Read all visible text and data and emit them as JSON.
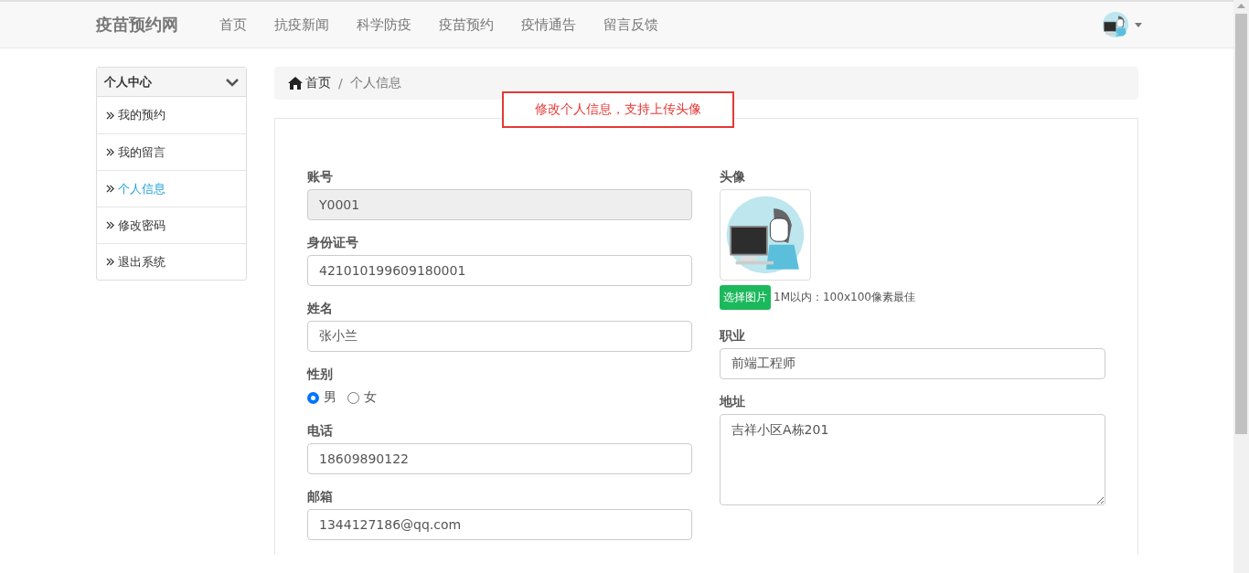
{
  "navbar": {
    "brand": "疫苗预约网",
    "links": [
      {
        "label": "首页",
        "selected": false
      },
      {
        "label": "抗疫新闻",
        "selected": false
      },
      {
        "label": "科学防疫",
        "selected": false
      },
      {
        "label": "疫苗预约",
        "selected": false
      },
      {
        "label": "疫情通告",
        "selected": false
      },
      {
        "label": "留言反馈",
        "selected": false
      }
    ]
  },
  "sidebar": {
    "title": "个人中心",
    "expanded": true,
    "items": [
      {
        "label": "我的预约",
        "selected": false
      },
      {
        "label": "我的留言",
        "selected": false
      },
      {
        "label": "个人信息",
        "selected": true
      },
      {
        "label": "修改密码",
        "selected": false
      },
      {
        "label": "退出系统",
        "selected": false
      }
    ]
  },
  "breadcrumb": {
    "separator": "/",
    "items": [
      "首页",
      "个人信息"
    ]
  },
  "annotation": "修改个人信息，支持上传头像",
  "form": {
    "left": [
      {
        "kind": "input",
        "label": "账号",
        "value": "Y0001",
        "disabled": true
      },
      {
        "kind": "input",
        "label": "身份证号",
        "value": "421010199609180001",
        "disabled": false
      },
      {
        "kind": "input",
        "label": "姓名",
        "value": "张小兰",
        "disabled": false
      },
      {
        "kind": "radio",
        "label": "性别",
        "options": [
          {
            "label": "男",
            "selected": true
          },
          {
            "label": "女",
            "selected": false
          }
        ]
      },
      {
        "kind": "input",
        "label": "电话",
        "value": "18609890122",
        "disabled": false
      },
      {
        "kind": "input",
        "label": "邮箱",
        "value": "1344127186@qq.com",
        "disabled": false
      }
    ],
    "avatar": {
      "label": "头像",
      "button": "选择图片",
      "hint": "1M以内：100x100像素最佳"
    },
    "right": [
      {
        "kind": "input",
        "label": "职业",
        "value": "前端工程师",
        "disabled": false
      },
      {
        "kind": "textarea",
        "label": "地址",
        "value": "吉祥小区A栋201",
        "disabled": false
      }
    ]
  }
}
